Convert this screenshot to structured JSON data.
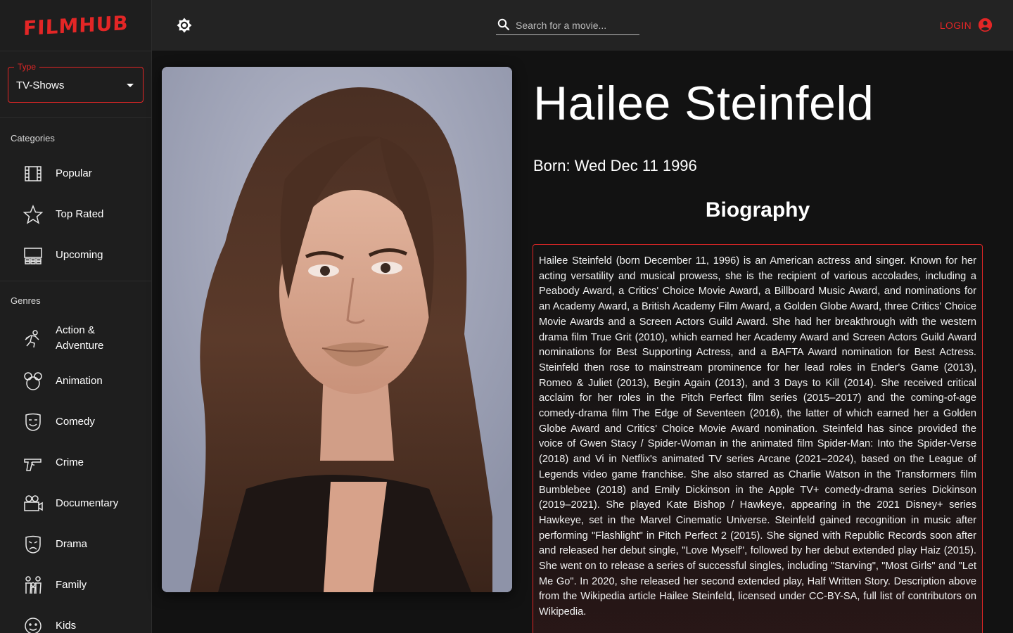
{
  "app": {
    "logo": "FILMHUB"
  },
  "sidebar": {
    "type_select": {
      "legend": "Type",
      "value": "TV-Shows"
    },
    "categories": {
      "title": "Categories",
      "items": [
        {
          "label": "Popular",
          "icon": "film-icon"
        },
        {
          "label": "Top Rated",
          "icon": "star-icon"
        },
        {
          "label": "Upcoming",
          "icon": "theater-icon"
        }
      ]
    },
    "genres": {
      "title": "Genres",
      "items": [
        {
          "label": "Action & Adventure",
          "icon": "fighter-icon"
        },
        {
          "label": "Animation",
          "icon": "mouse-ears-icon"
        },
        {
          "label": "Comedy",
          "icon": "happy-mask-icon"
        },
        {
          "label": "Crime",
          "icon": "pistol-icon"
        },
        {
          "label": "Documentary",
          "icon": "video-camera-icon"
        },
        {
          "label": "Drama",
          "icon": "sad-mask-icon"
        },
        {
          "label": "Family",
          "icon": "family-icon"
        },
        {
          "label": "Kids",
          "icon": "kids-icon"
        }
      ]
    }
  },
  "topbar": {
    "search": {
      "placeholder": "Search for a movie..."
    },
    "login_label": "LOGIN"
  },
  "person": {
    "name": "Hailee Steinfeld",
    "born": "Born: Wed Dec 11 1996",
    "bio_heading": "Biography",
    "biography": "Hailee Steinfeld (born December 11, 1996) is an American actress and singer. Known for her acting versatility and musical prowess, she is the recipient of various accolades, including a Peabody Award, a Critics' Choice Movie Award, a Billboard Music Award, and nominations for an Academy Award, a British Academy Film Award, a Golden Globe Award, three Critics' Choice Movie Awards and a Screen Actors Guild Award. She had her breakthrough with the western drama film True Grit (2010), which earned her Academy Award and Screen Actors Guild Award nominations for Best Supporting Actress, and a BAFTA Award nomination for Best Actress. Steinfeld then rose to mainstream prominence for her lead roles in Ender's Game (2013), Romeo & Juliet (2013), Begin Again (2013), and 3 Days to Kill (2014). She received critical acclaim for her roles in the Pitch Perfect film series (2015–2017) and the coming-of-age comedy-drama film The Edge of Seventeen (2016), the latter of which earned her a Golden Globe Award and Critics' Choice Movie Award nomination. Steinfeld has since provided the voice of Gwen Stacy / Spider-Woman in the animated film Spider-Man: Into the Spider-Verse (2018) and Vi in Netflix's animated TV series Arcane (2021–2024), based on the League of Legends video game franchise. She also starred as Charlie Watson in the Transformers film Bumblebee (2018) and Emily Dickinson in the Apple TV+ comedy-drama series Dickinson (2019–2021). She played Kate Bishop / Hawkeye, appearing in the 2021 Disney+ series Hawkeye, set in the Marvel Cinematic Universe. Steinfeld gained recognition in music after performing \"Flashlight\" in Pitch Perfect 2 (2015). She signed with Republic Records soon after and released her debut single, \"Love Myself\", followed by her debut extended play Haiz (2015). She went on to release a series of successful singles, including \"Starving\", \"Most Girls\" and \"Let Me Go\". In 2020, she released her second extended play, Half Written Story. Description above from the Wikipedia article Hailee Steinfeld, licensed under CC-BY-SA, full list of contributors on Wikipedia."
  },
  "colors": {
    "accent": "#e32626",
    "background": "#121212",
    "sidebar": "#1e1e1e",
    "topbar": "#232323"
  }
}
